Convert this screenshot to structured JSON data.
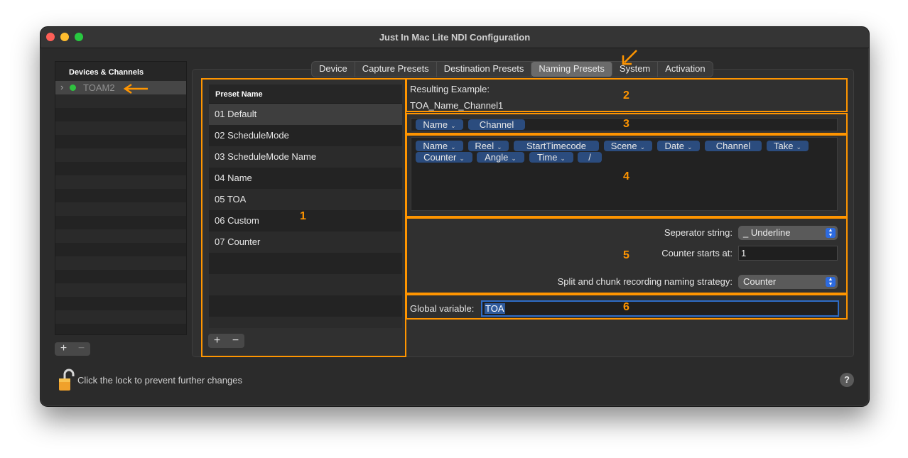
{
  "window": {
    "title": "Just In Mac Lite NDI Configuration"
  },
  "sidebar": {
    "header": "Devices & Channels",
    "device": {
      "label": "TOAM2",
      "chevron": "chevron-right-icon",
      "status_color": "#2fc13f"
    },
    "add_label": "+",
    "remove_label": "−"
  },
  "tabs": [
    {
      "label": "Device"
    },
    {
      "label": "Capture Presets"
    },
    {
      "label": "Destination Presets"
    },
    {
      "label": "Naming Presets",
      "selected": true
    },
    {
      "label": "System"
    },
    {
      "label": "Activation"
    }
  ],
  "presets": {
    "header": "Preset Name",
    "items": [
      "01 Default",
      "02 ScheduleMode",
      "03 ScheduleMode Name",
      "04 Name",
      "05 TOA",
      "06 Custom",
      "07 Counter"
    ],
    "add_label": "+",
    "remove_label": "−"
  },
  "example": {
    "label": "Resulting Example:",
    "value": "TOA_Name_Channel1"
  },
  "current_tokens": [
    {
      "label": "Name",
      "menu": true
    },
    {
      "label": "Channel",
      "menu": false
    }
  ],
  "available_tokens": [
    {
      "label": "Name",
      "menu": true
    },
    {
      "label": "Reel",
      "menu": true
    },
    {
      "label": "StartTimecode",
      "menu": false
    },
    {
      "label": "Scene",
      "menu": true
    },
    {
      "label": "Date",
      "menu": true
    },
    {
      "label": "Channel",
      "menu": false
    },
    {
      "label": "Take",
      "menu": true
    },
    {
      "label": "Counter",
      "menu": true
    },
    {
      "label": "Angle",
      "menu": true
    },
    {
      "label": "Time",
      "menu": true
    },
    {
      "label": "/",
      "menu": false
    }
  ],
  "settings": {
    "separator_label": "Seperator string:",
    "separator_value": "_ Underline",
    "counter_label": "Counter starts at:",
    "counter_value": "1",
    "split_label": "Split and chunk recording naming strategy:",
    "split_value": "Counter"
  },
  "global": {
    "label": "Global variable:",
    "value": "TOA"
  },
  "footer": {
    "lock_text": "Click the lock to prevent further changes",
    "help_label": "?"
  },
  "annotations": {
    "accent_color": "#ff9500",
    "labels": [
      "1",
      "2",
      "3",
      "4",
      "5",
      "6"
    ]
  },
  "colors": {
    "token": "#2b4c7e",
    "focus": "#2e6cc6",
    "window": "#2b2b2b"
  }
}
